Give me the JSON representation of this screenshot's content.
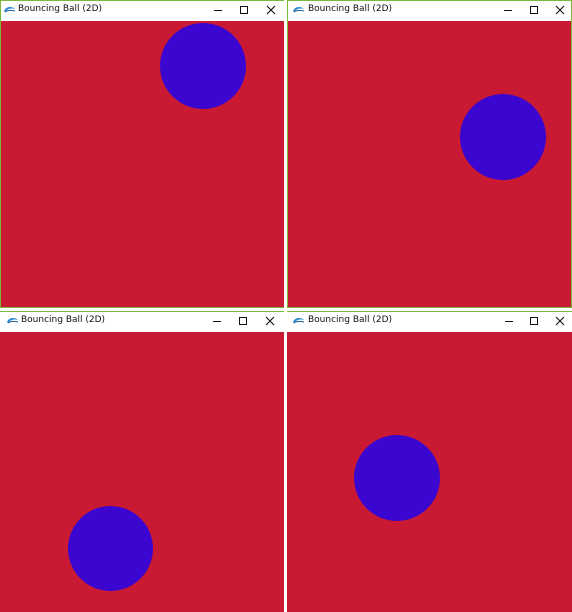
{
  "app": {
    "title": "Bouncing Ball (2D)",
    "canvas_color": "#ca1a33",
    "ball_color": "#3b06d0"
  },
  "windows": [
    {
      "id": "top-left"
    },
    {
      "id": "top-right"
    },
    {
      "id": "bottom-left"
    },
    {
      "id": "bottom-right"
    }
  ]
}
